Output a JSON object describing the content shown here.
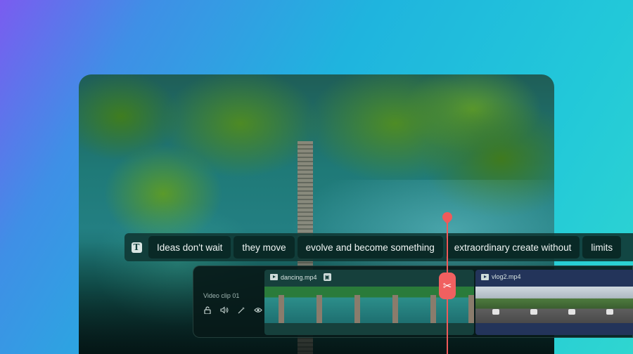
{
  "captions": {
    "text_tool_icon": "T",
    "chips": [
      "Ideas don't wait",
      "they move",
      "evolve and become something",
      "extraordinary create without",
      "limits"
    ]
  },
  "timeline": {
    "track_label": "Video clip 01",
    "track_icons": [
      "unlock-icon",
      "volume-icon",
      "effects-icon",
      "eye-icon"
    ],
    "clips": [
      {
        "name": "dancing.mp4",
        "icon": "play-icon"
      },
      {
        "name": "vlog2.mp4",
        "icon": "play-icon"
      }
    ]
  },
  "playhead": {
    "cut_icon": "✂"
  },
  "colors": {
    "accent": "#f05a5a",
    "caption_chip": "#0a2825",
    "clip1_bg": "#16403c",
    "clip2_bg": "#23345a"
  }
}
